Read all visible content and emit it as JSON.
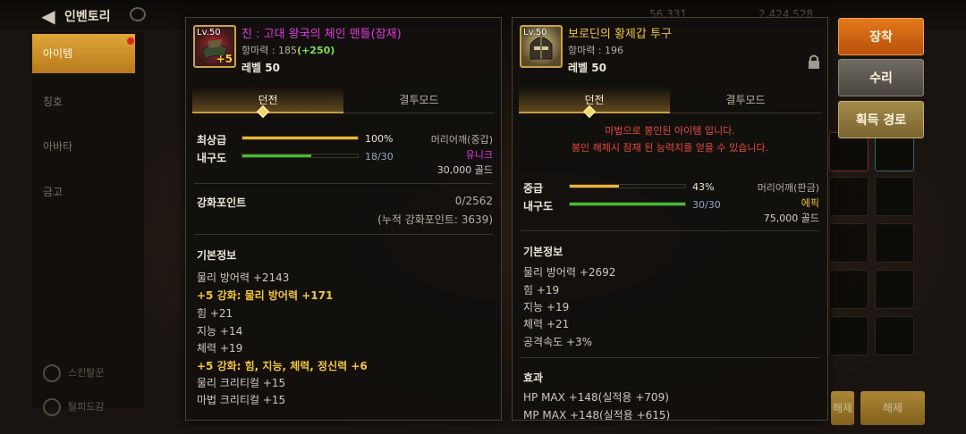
{
  "topbar": {
    "title": "인벤토리",
    "stat_a": "56,331",
    "stat_b": "2,424,528"
  },
  "sidebar": {
    "items": [
      {
        "label": "아이템"
      },
      {
        "label": "칭호"
      },
      {
        "label": "아바타"
      },
      {
        "label": "금고"
      }
    ],
    "bottom": [
      {
        "label": "스킨탈꾼"
      },
      {
        "label": "탈피도감"
      }
    ]
  },
  "left_item": {
    "icon_level": "Lv.50",
    "icon_plus": "+5",
    "name": "진 : 고대 왕국의 체인 맨틀(잠재)",
    "name_color": "#e03be0",
    "defense_label": "항마력 : 185",
    "defense_bonus": "(+250)",
    "level": "레벨 50",
    "tabs": [
      "던전",
      "결투모드"
    ],
    "grade_label": "최상급",
    "grade_pct": "100%",
    "grade_value": 1.0,
    "durability_label": "내구도",
    "durability_text": "18/30",
    "durability_value": 0.6,
    "slot_type": "머리어깨(중갑)",
    "rarity": "유니크",
    "rarity_color": "#e03be0",
    "price": "30,000 골드",
    "reinforce_label": "강화포인트",
    "reinforce_value": "0/2562",
    "reinforce_total": "(누적 강화포인트: 3639)",
    "basic_title": "기본정보",
    "basic_lines": [
      {
        "text": "물리 방어력 +2143",
        "gold": false
      },
      {
        "text": " +5 강화: 물리 방어력 +171",
        "gold": true
      },
      {
        "text": "힘 +21",
        "gold": false
      },
      {
        "text": "지능 +14",
        "gold": false
      },
      {
        "text": "체력 +19",
        "gold": false
      },
      {
        "text": " +5 강화: 힘, 지능, 체력, 정신력 +6",
        "gold": true
      },
      {
        "text": "물리 크리티컬 +15",
        "gold": false
      },
      {
        "text": "마법 크리티컬 +15",
        "gold": false
      }
    ]
  },
  "right_item": {
    "icon_level": "Lv.50",
    "name": "보로딘의 황제갑 투구",
    "name_color": "#f2c43b",
    "defense_label": "항마력 : 196",
    "level": "레벨 50",
    "tabs": [
      "던전",
      "결투모드"
    ],
    "warning_1": "마법으로 봉인된 아이템 입니다.",
    "warning_2": "봉인 해제시 잠재 된 능력치를 얻을 수 있습니다.",
    "grade_label": "중급",
    "grade_pct": "43%",
    "grade_value": 0.43,
    "durability_label": "내구도",
    "durability_text": "30/30",
    "durability_value": 1.0,
    "slot_type": "머리어깨(판금)",
    "rarity": "에픽",
    "rarity_color": "#f2c43b",
    "price": "75,000 골드",
    "basic_title": "기본정보",
    "basic_lines": [
      {
        "text": "물리 방어력 +2692"
      },
      {
        "text": "힘 +19"
      },
      {
        "text": "지능 +19"
      },
      {
        "text": "체력 +21"
      },
      {
        "text": "공격속도 +3%"
      }
    ],
    "effect_title": "효과",
    "effect_lines": [
      {
        "text": "HP MAX +148(실적용 +709)"
      },
      {
        "text": "MP MAX +148(실적용 +615)"
      }
    ]
  },
  "actions": {
    "equip": "장착",
    "repair": "수리",
    "route": "획득 경로"
  },
  "bottom_buttons": {
    "left": "해제",
    "right": "해제"
  },
  "colors": {
    "grade_bar": "#f1b52c",
    "durability_bar": "#3fbf2e",
    "accent_gold": "#c99d3e"
  }
}
